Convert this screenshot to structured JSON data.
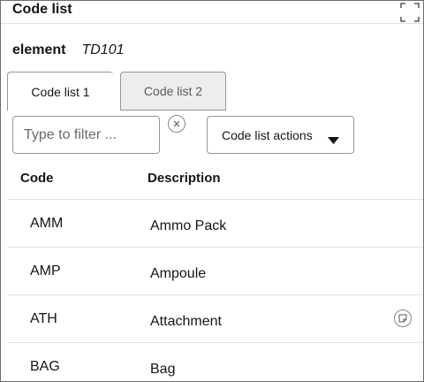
{
  "panel": {
    "title": "Code list",
    "expand_icon": "fullscreen-expand-icon"
  },
  "element": {
    "label": "element",
    "value": "TD101"
  },
  "tabs": [
    {
      "label": "Code list 1",
      "selected": true
    },
    {
      "label": "Code list 2",
      "selected": false
    }
  ],
  "filter": {
    "value": "",
    "placeholder": "Type to filter ...",
    "clear_icon": "clear-x-icon"
  },
  "actions": {
    "label": "Code list actions",
    "caret_icon": "caret-down-icon"
  },
  "table": {
    "columns": [
      "Code",
      "Description"
    ],
    "rows": [
      {
        "code": "AMM",
        "description": "Ammo Pack"
      },
      {
        "code": "AMP",
        "description": "Ampoule"
      },
      {
        "code": "ATH",
        "description": "Attachment",
        "note_icon": "note-icon"
      },
      {
        "code": "BAG",
        "description": "Bag"
      }
    ]
  },
  "colors": {
    "border": "#9a9590",
    "divider": "#e4e1dd",
    "inactive_tab": "#ededed",
    "text": "#161513"
  }
}
